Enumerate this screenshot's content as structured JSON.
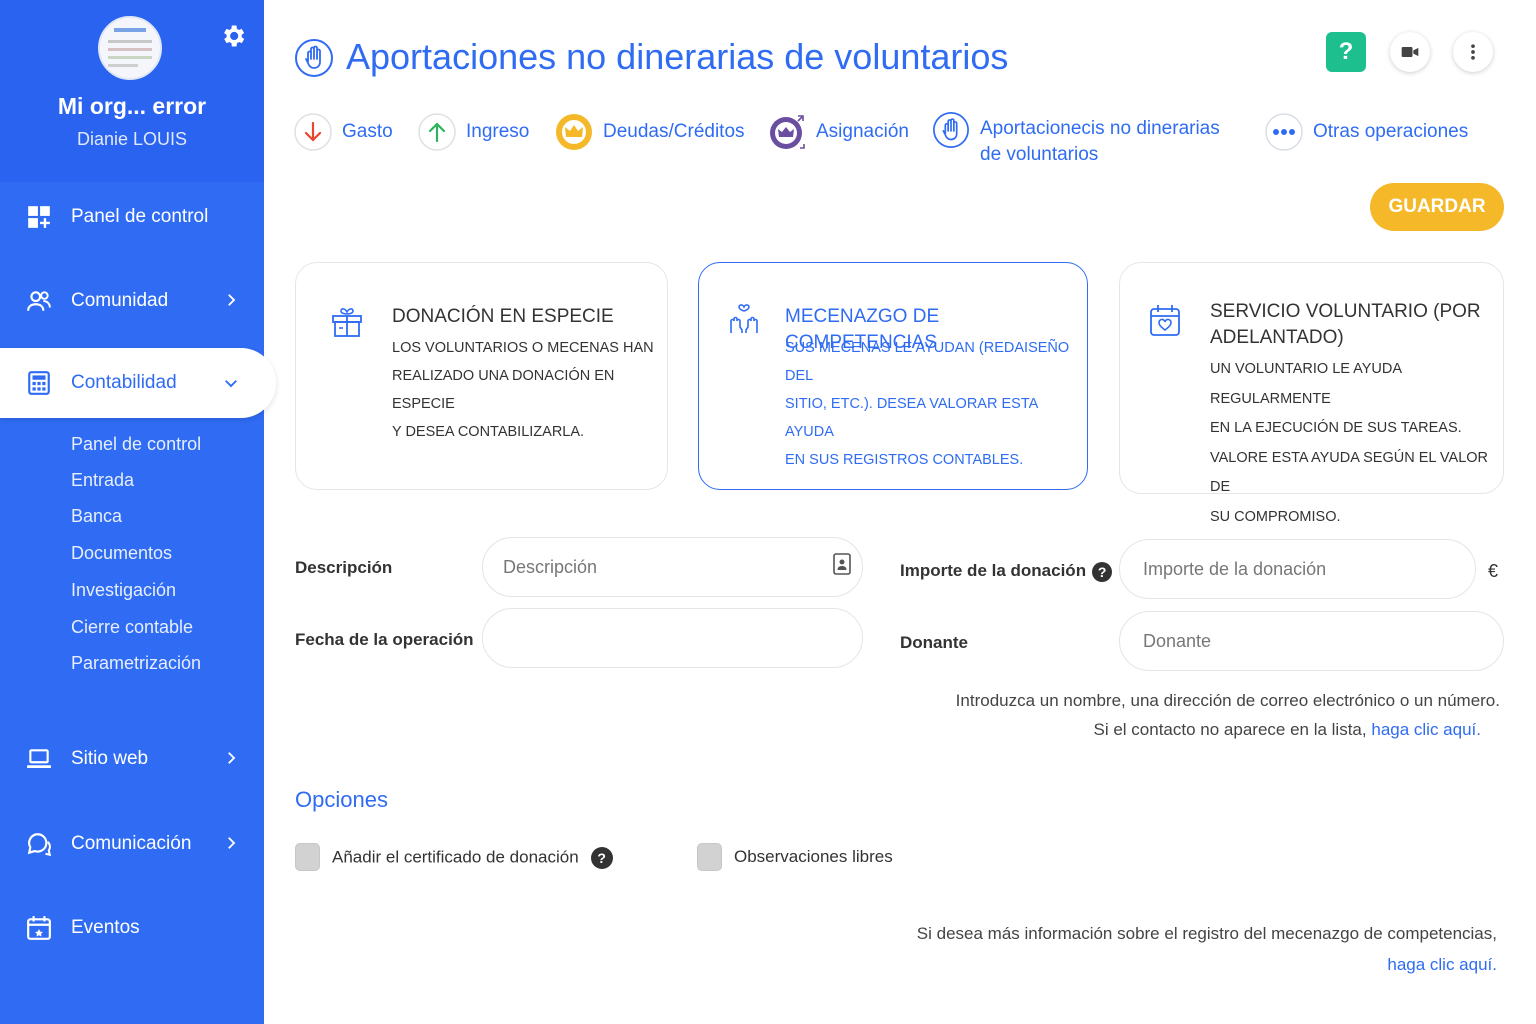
{
  "sidebar": {
    "org_name": "Mi org... error",
    "user_name": "Dianie LOUIS",
    "items": [
      {
        "label": "Panel de control",
        "icon": "dashboard-icon"
      },
      {
        "label": "Comunidad",
        "icon": "community-icon"
      },
      {
        "label": "Contabilidad",
        "icon": "calculator-icon"
      },
      {
        "label": "Sitio web",
        "icon": "laptop-icon"
      },
      {
        "label": "Comunicación",
        "icon": "chat-icon"
      },
      {
        "label": "Eventos",
        "icon": "calendar-icon"
      }
    ],
    "subitems": [
      "Panel de control",
      "Entrada",
      "Banca",
      "Documentos",
      "Investigación",
      "Cierre contable",
      "Parametrización"
    ]
  },
  "header": {
    "title": "Aportaciones no dinerarias de voluntarios",
    "help": "?"
  },
  "operations": [
    {
      "label": "Gasto"
    },
    {
      "label": "Ingreso"
    },
    {
      "label": "Deudas/Créditos"
    },
    {
      "label": "Asignación"
    },
    {
      "label_line1": "Aportacionecis no dinerarias",
      "label_line2": "de voluntarios"
    },
    {
      "label": "Otras operaciones"
    }
  ],
  "save_label": "GUARDAR",
  "cards": [
    {
      "title": "DONACIÓN EN ESPECIE",
      "desc": [
        "LOS VOLUNTARIOS O MECENAS HAN",
        "REALIZADO UNA DONACIÓN EN ESPECIE",
        "Y DESEA CONTABILIZARLA."
      ]
    },
    {
      "title": "MECENAZGO DE COMPETENCIAS",
      "desc": [
        "SUS MECENAS LE AYUDAN (REDAISEÑO DEL",
        "SITIO, ETC.). DESEA VALORAR ESTA AYUDA",
        "EN SUS REGISTROS CONTABLES."
      ]
    },
    {
      "title_line1": "SERVICIO VOLUNTARIO (POR",
      "title_line2": "ADELANTADO)",
      "desc": [
        "UN VOLUNTARIO LE AYUDA REGULARMENTE",
        "EN LA EJECUCIÓN DE SUS TAREAS.",
        "VALORE ESTA AYUDA SEGÚN EL VALOR DE",
        "SU COMPROMISO."
      ]
    }
  ],
  "form": {
    "desc_label": "Descripción",
    "desc_placeholder": "Descripción",
    "date_label": "Fecha de la operación",
    "date_value": "",
    "amount_label": "Importe de la donación",
    "amount_placeholder": "Importe de la donación",
    "currency": "€",
    "donor_label": "Donante",
    "donor_placeholder": "Donante",
    "hint_line1": "Introduzca un nombre, una dirección de correo electrónico o un número.",
    "hint_line2_prefix": "Si el contacto no aparece en la lista,",
    "hint_line2_link": "haga clic aquí."
  },
  "options": {
    "title": "Opciones",
    "certificate_label": "Añadir el certificado de donación",
    "notes_label": "Observaciones libres"
  },
  "footer": {
    "text": "Si desea más información sobre el registro del mecenazgo de competencias,",
    "link": "haga clic aquí."
  },
  "colors": {
    "primary": "#2f6cf3",
    "sidebar": "#2f6cf3",
    "save": "#f5b829",
    "help": "#1dbf8f"
  }
}
